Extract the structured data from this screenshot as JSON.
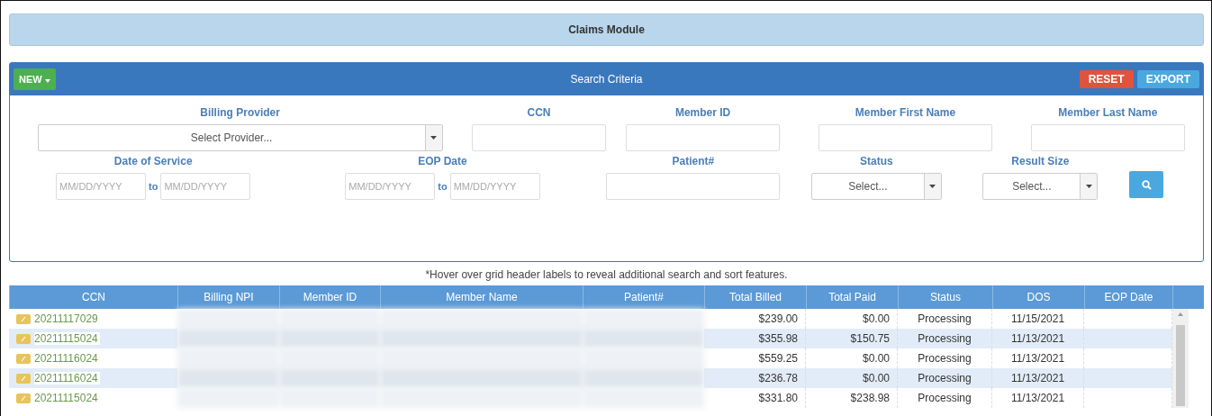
{
  "module_title": "Claims Module",
  "search_panel": {
    "new_button": "NEW",
    "title": "Search Criteria",
    "reset_button": "RESET",
    "export_button": "EXPORT",
    "fields": [
      {
        "kind": "select",
        "label": "Billing Provider",
        "placeholder": "Select Provider..."
      },
      {
        "kind": "text",
        "label": "CCN"
      },
      {
        "kind": "text",
        "label": "Member ID"
      },
      {
        "kind": "text",
        "label": "Member First Name"
      },
      {
        "kind": "text",
        "label": "Member Last Name"
      },
      {
        "kind": "daterange",
        "label": "Date of Service",
        "from_placeholder": "MM/DD/YYYY",
        "joiner": "to",
        "to_placeholder": "MM/DD/YYYY"
      },
      {
        "kind": "daterange",
        "label": "EOP Date",
        "from_placeholder": "MM/DD/YYYY",
        "joiner": "to",
        "to_placeholder": "MM/DD/YYYY"
      },
      {
        "kind": "text",
        "label": "Patient#"
      },
      {
        "kind": "select",
        "label": "Status",
        "placeholder": "Select..."
      },
      {
        "kind": "select",
        "label": "Result Size",
        "placeholder": "Select..."
      },
      {
        "kind": "search"
      }
    ]
  },
  "hint": "*Hover over grid header labels to reveal additional search and sort features.",
  "table": {
    "columns": [
      "CCN",
      "Billing NPI",
      "Member ID",
      "Member Name",
      "Patient#",
      "Total Billed",
      "Total Paid",
      "Status",
      "DOS",
      "EOP Date"
    ],
    "rows": [
      {
        "ccn": "20211117029",
        "total_billed": "$239.00",
        "total_paid": "$0.00",
        "status": "Processing",
        "dos": "11/15/2021"
      },
      {
        "ccn": "20211115024",
        "total_billed": "$355.98",
        "total_paid": "$150.75",
        "status": "Processing",
        "dos": "11/13/2021"
      },
      {
        "ccn": "20211116024",
        "total_billed": "$559.25",
        "total_paid": "$0.00",
        "status": "Processing",
        "dos": "11/13/2021"
      },
      {
        "ccn": "20211116024",
        "total_billed": "$236.78",
        "total_paid": "$0.00",
        "status": "Processing",
        "dos": "11/13/2021"
      },
      {
        "ccn": "20211115024",
        "total_billed": "$331.80",
        "total_paid": "$238.98",
        "status": "Processing",
        "dos": "11/13/2021"
      }
    ]
  }
}
